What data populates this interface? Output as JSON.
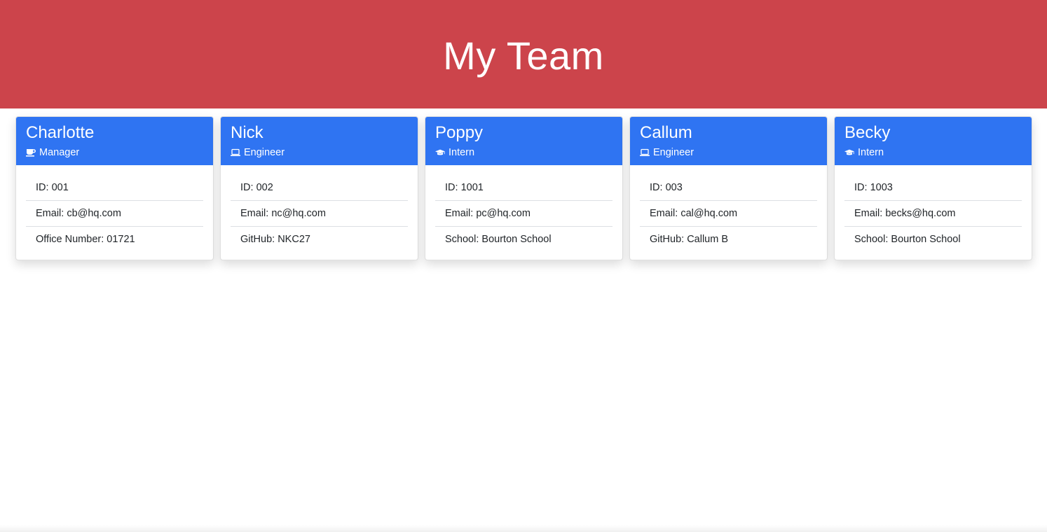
{
  "header": {
    "title": "My Team",
    "background": "#cc444b"
  },
  "colors": {
    "card_header": "#2f74f2"
  },
  "team": [
    {
      "name": "Charlotte",
      "role": "Manager",
      "role_icon": "coffee-mug-icon",
      "details": [
        {
          "label": "ID",
          "value": "001"
        },
        {
          "label": "Email",
          "value": "cb@hq.com"
        },
        {
          "label": "Office Number",
          "value": "01721"
        }
      ]
    },
    {
      "name": "Nick",
      "role": "Engineer",
      "role_icon": "laptop-icon",
      "details": [
        {
          "label": "ID",
          "value": "002"
        },
        {
          "label": "Email",
          "value": "nc@hq.com"
        },
        {
          "label": "GitHub",
          "value": "NKC27"
        }
      ]
    },
    {
      "name": "Poppy",
      "role": "Intern",
      "role_icon": "graduation-cap-icon",
      "details": [
        {
          "label": "ID",
          "value": "1001"
        },
        {
          "label": "Email",
          "value": "pc@hq.com"
        },
        {
          "label": "School",
          "value": "Bourton School"
        }
      ]
    },
    {
      "name": "Callum",
      "role": "Engineer",
      "role_icon": "laptop-icon",
      "details": [
        {
          "label": "ID",
          "value": "003"
        },
        {
          "label": "Email",
          "value": "cal@hq.com"
        },
        {
          "label": "GitHub",
          "value": "Callum B"
        }
      ]
    },
    {
      "name": "Becky",
      "role": "Intern",
      "role_icon": "graduation-cap-icon",
      "details": [
        {
          "label": "ID",
          "value": "1003"
        },
        {
          "label": "Email",
          "value": "becks@hq.com"
        },
        {
          "label": "School",
          "value": "Bourton School"
        }
      ]
    }
  ]
}
